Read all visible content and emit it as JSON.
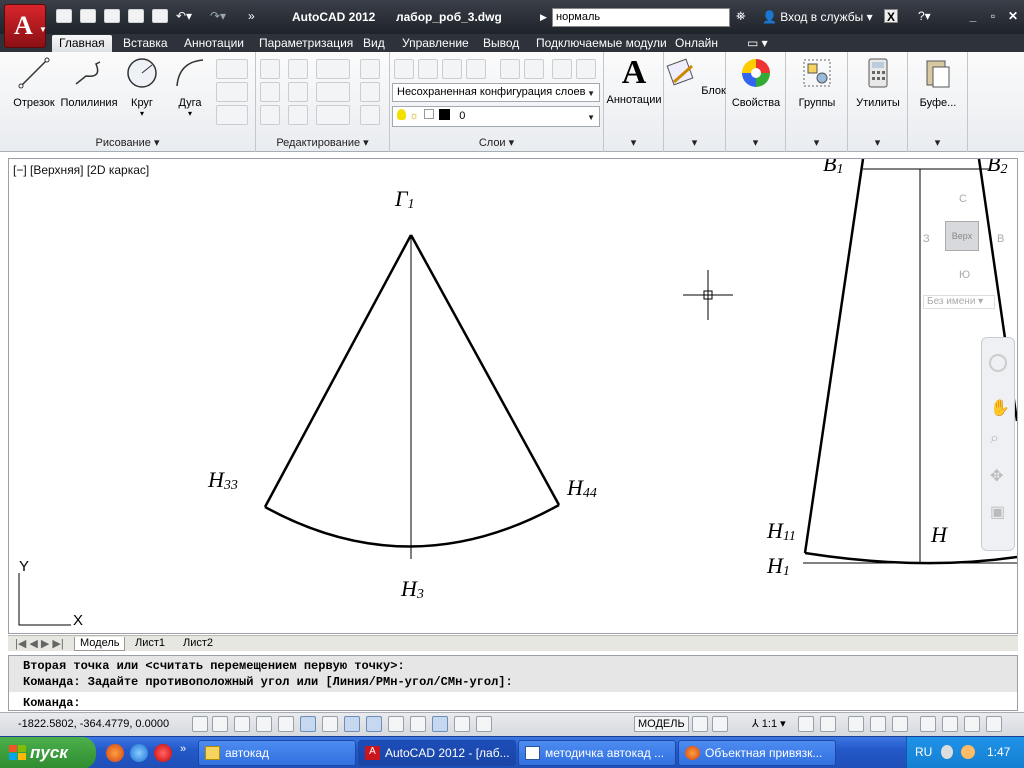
{
  "window": {
    "app_title": "AutoCAD 2012",
    "file_name": "лабор_роб_3.dwg",
    "search_value": "нормаль",
    "login_label": "Вход в службы"
  },
  "ribbon_tabs": [
    "Главная",
    "Вставка",
    "Аннотации",
    "Параметризация",
    "Вид",
    "Управление",
    "Вывод",
    "Подключаемые модули",
    "Онлайн"
  ],
  "draw_panel": {
    "title": "Рисование",
    "buttons": [
      "Отрезок",
      "Полилиния",
      "Круг",
      "Дуга"
    ]
  },
  "modify_panel": {
    "title": "Редактирование"
  },
  "layers_panel": {
    "title": "Слои",
    "layer_state": "Несохраненная конфигурация слоев",
    "current_layer": "0"
  },
  "big_buttons": [
    "Аннотации",
    "Блок",
    "Свойства",
    "Группы",
    "Утилиты",
    "Буфе..."
  ],
  "viewport": {
    "label": "[−] [Верхняя] [2D каркас]",
    "labels": {
      "g1": "Г",
      "g1_sub": "1",
      "h33": "Н",
      "h33_sub": "33",
      "h44": "Н",
      "h44_sub": "44",
      "h3": "Н",
      "h3_sub": "3",
      "b1": "В",
      "b1_sub": "1",
      "b2": "В",
      "b2_sub": "2",
      "h11": "Н",
      "h11_sub": "11",
      "h1": "Н",
      "h1_sub": "1",
      "h": "Н"
    },
    "ucs_y": "Y",
    "ucs_x": "X"
  },
  "viewcube": {
    "north": "С",
    "south": "Ю",
    "west": "З",
    "east": "В",
    "face": "Верх",
    "wcs": "Без имени"
  },
  "layout_tabs": [
    "Модель",
    "Лист1",
    "Лист2"
  ],
  "command_line": {
    "line1": "Вторая точка или <считать перемещением первую точку>:",
    "line2": "Команда: Задайте противоположный угол или [Линия/РМн-угол/СМн-угол]:",
    "prompt": "Команда:"
  },
  "status_bar": {
    "coordinates": "-1822.5802, -364.4779, 0.0000",
    "model_label": "МОДЕЛЬ",
    "scale": "1:1"
  },
  "taskbar": {
    "start_label": "пуск",
    "tasks": [
      "автокад",
      "AutoCAD 2012 - [лаб...",
      "методичка автокад ...",
      "Объектная привязк..."
    ],
    "language": "RU",
    "clock": "1:47"
  },
  "colors": {
    "title_bg": "#262a31",
    "app_button": "#c8161c",
    "taskbar": "#2459c9",
    "start": "#3a9a3a"
  }
}
